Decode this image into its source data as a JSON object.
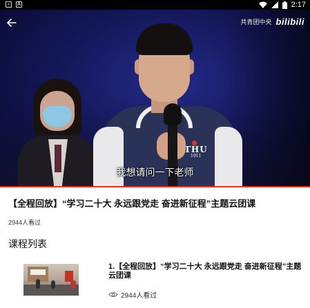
{
  "status_bar": {
    "time": "2:17",
    "icons": [
      "image-icon",
      "text-a-icon",
      "wifi-icon",
      "signal-icon",
      "battery-icon"
    ]
  },
  "video": {
    "watermark_text": "共青团中央",
    "watermark_logo": "bilibili",
    "subtitle": "我想请问一下老师",
    "jacket_logo": "THU",
    "jacket_year": "1911"
  },
  "info": {
    "title": "【全程回放】“学习二十大 永远跟党走 奋进新征程”主题云团课",
    "views": "2944人看过"
  },
  "course_list": {
    "heading": "课程列表",
    "items": [
      {
        "title": "1.【全程回放】“学习二十大 永远跟党走 奋进新征程”主题云团课",
        "views": "2944人看过"
      }
    ]
  },
  "colors": {
    "accent": "#e0312a",
    "status_bar": "#000000"
  }
}
